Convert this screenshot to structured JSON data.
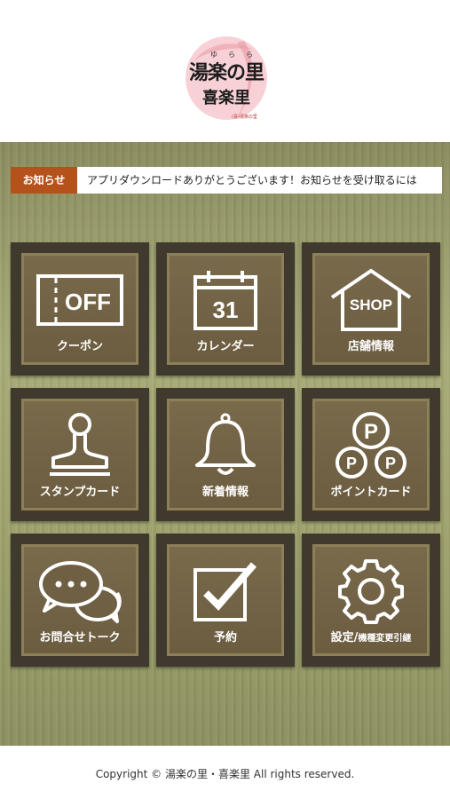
{
  "logo": {
    "ruby": "ゆらら",
    "line1": "湯楽の里",
    "line2": "喜楽里",
    "tagline": "(喜)湯楽の里"
  },
  "news": {
    "tag": "お知らせ",
    "text": "アプリダウンロードありがとうございます！お知らせを受け取るには"
  },
  "tiles": [
    {
      "label": "クーポン",
      "icon": "coupon-off-icon",
      "icon_text": "OFF"
    },
    {
      "label": "カレンダー",
      "icon": "calendar-icon",
      "icon_text": "31"
    },
    {
      "label": "店舗情報",
      "icon": "shop-icon",
      "icon_text": "SHOP"
    },
    {
      "label": "スタンプカード",
      "icon": "stamp-icon"
    },
    {
      "label": "新着情報",
      "icon": "bell-icon"
    },
    {
      "label": "ポイントカード",
      "icon": "points-icon",
      "icon_text": "P"
    },
    {
      "label": "お問合せトーク",
      "icon": "chat-icon"
    },
    {
      "label": "予約",
      "icon": "checkbox-icon"
    },
    {
      "label_main": "設定/",
      "label_small": "機種変更引継",
      "icon": "gear-icon"
    }
  ],
  "footer": {
    "copyright": "Copyright © 湯楽の里・喜楽里 All rights reserved."
  }
}
